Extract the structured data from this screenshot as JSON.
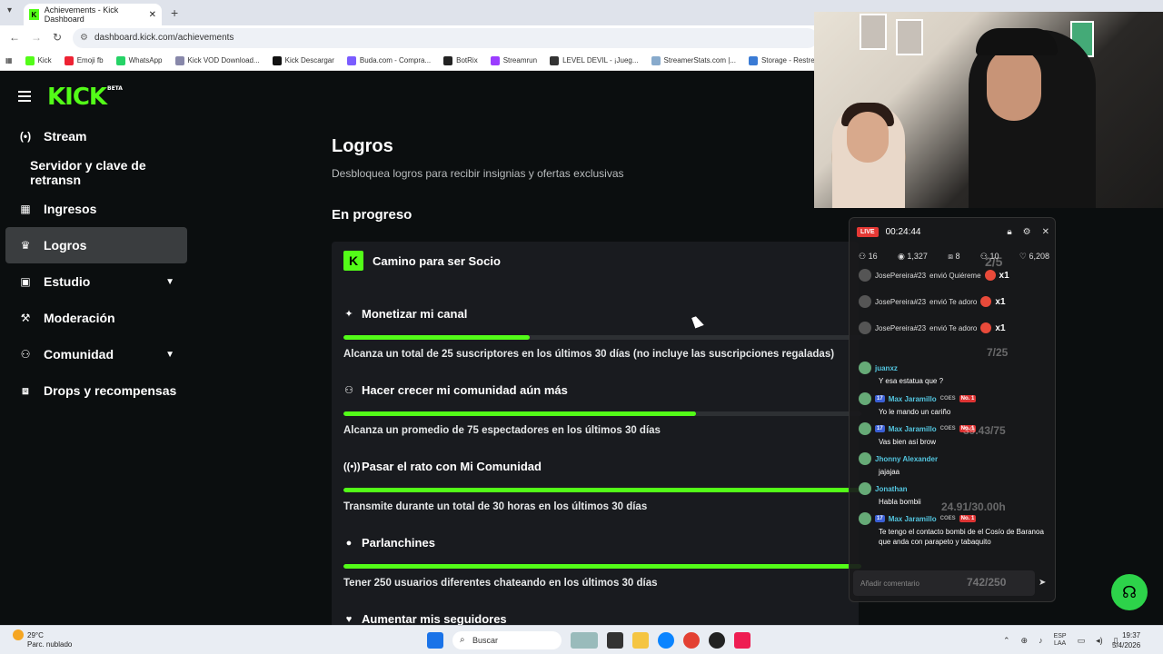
{
  "browser": {
    "tab_title": "Achievements - Kick Dashboard",
    "url": "dashboard.kick.com/achievements",
    "bookmarks": [
      "Kick",
      "Emoji fb",
      "WhatsApp",
      "Kick VOD Download...",
      "Kick Descargar",
      "Buda.com - Compra...",
      "BotRix",
      "Streamrun",
      "LEVEL DEVIL - ¡Jueg...",
      "StreamerStats.com |...",
      "Storage - Restream"
    ]
  },
  "logo": {
    "text": "KICK",
    "badge": "BETA"
  },
  "sidebar": {
    "items": [
      {
        "label": "Stream",
        "icon": "broadcast-icon",
        "glyph": "(•)"
      },
      {
        "label": "Servidor y clave de retransn",
        "icon": "",
        "glyph": ""
      },
      {
        "label": "Ingresos",
        "icon": "money-icon",
        "glyph": "▦"
      },
      {
        "label": "Logros",
        "icon": "trophy-icon",
        "glyph": "♛"
      },
      {
        "label": "Estudio",
        "icon": "studio-icon",
        "glyph": "▣"
      },
      {
        "label": "Moderación",
        "icon": "wrench-icon",
        "glyph": "⚒"
      },
      {
        "label": "Comunidad",
        "icon": "community-icon",
        "glyph": "⚇"
      },
      {
        "label": "Drops y recompensas",
        "icon": "gift-icon",
        "glyph": "⧈"
      }
    ]
  },
  "main": {
    "title": "Logros",
    "subtitle": "Desbloquea logros para recibir insignias y ofertas exclusivas",
    "section": "En progreso",
    "card_title": "Camino para ser Socio",
    "achievements": [
      {
        "title": "Monetizar mi canal",
        "icon": "sparkle-icon",
        "glyph": "✦",
        "progress": 0.36,
        "desc": "Alcanza un total de 25 suscriptores en los últimos 30 días (no incluye las suscripciones regaladas)"
      },
      {
        "title": "Hacer crecer mi comunidad aún más",
        "icon": "users-icon",
        "glyph": "⚇",
        "progress": 0.68,
        "desc": "Alcanza un promedio de 75 espectadores en los últimos 30 días"
      },
      {
        "title": "Pasar el rato con Mi Comunidad",
        "icon": "broadcast-icon",
        "glyph": "((•))",
        "progress": 1.0,
        "desc": "Transmite durante un total de 30 horas en los últimos 30 días"
      },
      {
        "title": "Parlanchines",
        "icon": "chat-icon",
        "glyph": "●",
        "progress": 1.0,
        "desc": "Tener 250 usuarios diferentes chateando en los últimos 30 días"
      },
      {
        "title": "Aumentar mis seguidores",
        "icon": "heart-icon",
        "glyph": "♥",
        "progress": 0,
        "desc": ""
      }
    ]
  },
  "chat": {
    "live": "LIVE",
    "timer": "00:24:44",
    "stats": [
      "16",
      "1,327",
      "8",
      "10",
      "6,208"
    ],
    "overlays": [
      "2/5",
      "7/25",
      "39.43/75",
      "24.91/30.00h",
      "742/250"
    ],
    "gifts": [
      {
        "user": "JosePereira#23",
        "action": "envió Quiéreme",
        "count": "x1"
      },
      {
        "user": "JosePereira#23",
        "action": "envió Te adoro",
        "count": "x1"
      },
      {
        "user": "JosePereira#23",
        "action": "envió Te adoro",
        "count": "x1"
      }
    ],
    "messages": [
      {
        "user": "juanxz",
        "text": "Y esa estatua que ?",
        "badges": false
      },
      {
        "user": "Max Jaramillo",
        "text": "Yo le mando un cariño",
        "badges": true
      },
      {
        "user": "Max Jaramillo",
        "text": "Vas bien así brow",
        "badges": true
      },
      {
        "user": "Jhonny Alexander",
        "text": "jajajaa",
        "badges": false
      },
      {
        "user": "Jonathan",
        "text": "Habla bombii",
        "badges": false
      },
      {
        "user": "Max Jaramillo",
        "text": "Te tengo el contacto bombi de el Cosío de Baranoa que anda con parapeto y tabaquito",
        "badges": true
      }
    ],
    "badge_sub": "17",
    "badge_cost": "COES",
    "badge_no": "No. 1",
    "input_placeholder": "Añadir comentario"
  },
  "taskbar": {
    "temp": "29°C",
    "weather": "Parc. nublado",
    "search": "Buscar",
    "lang1": "ESP",
    "lang2": "LAA",
    "time": "19:37",
    "date": "5/4/2026"
  },
  "colors": {
    "accent": "#53fc18",
    "bg": "#0b0e0f",
    "card": "#191b1f"
  }
}
